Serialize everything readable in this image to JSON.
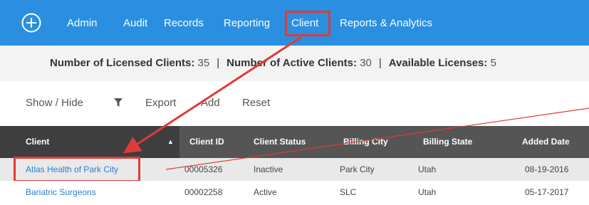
{
  "nav": {
    "items": [
      {
        "label": "Admin"
      },
      {
        "label": "Audit"
      },
      {
        "label": "Records"
      },
      {
        "label": "Reporting"
      },
      {
        "label": "Client",
        "active": true
      },
      {
        "label": "Reports & Analytics"
      }
    ]
  },
  "licenses": {
    "licensed_label": "Number of Licensed Clients:",
    "licensed_value": "35",
    "active_label": "Number of Active Clients:",
    "active_value": "30",
    "available_label": "Available Licenses:",
    "available_value": "5",
    "separator": "|"
  },
  "toolbar": {
    "show_hide": "Show / Hide",
    "export": "Export",
    "add": "Add",
    "reset": "Reset"
  },
  "table": {
    "columns": [
      "Client",
      "Client ID",
      "Client Status",
      "Billing City",
      "Billing State",
      "Added Date"
    ],
    "sort_indicator": "▲",
    "rows": [
      [
        "Atlas Health of Park City",
        "00005326",
        "Inactive",
        "Park City",
        "Utah",
        "08-19-2016"
      ],
      [
        "Bariatric Surgeons",
        "00002258",
        "Active",
        "SLC",
        "Utah",
        "05-17-2017"
      ]
    ]
  },
  "colors": {
    "nav_bg": "#2a8fe0",
    "annotation_red": "#e03a3a",
    "link_blue": "#2a7fd0",
    "header_dark": "#3e3e3e",
    "header_gray": "#555555"
  },
  "icons": {
    "logo": "circle-plus-icon",
    "filter": "funnel-icon"
  }
}
